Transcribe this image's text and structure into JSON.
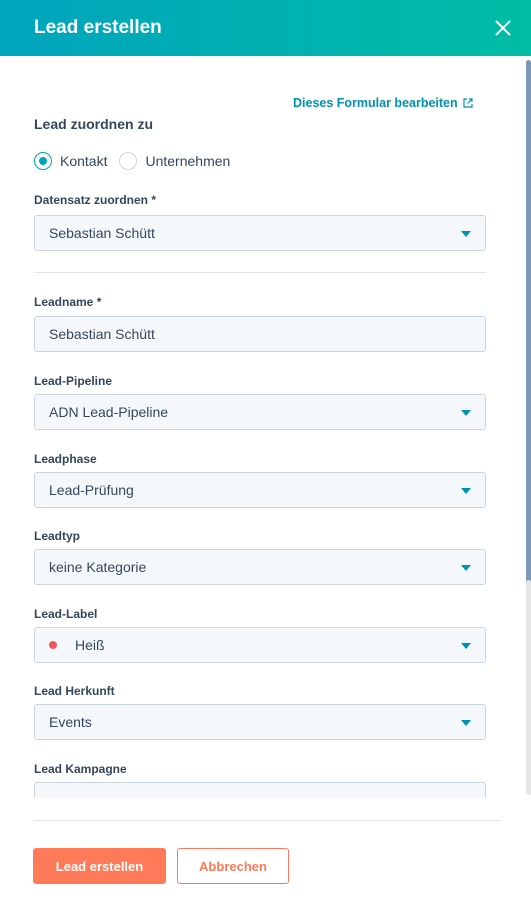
{
  "header": {
    "title": "Lead erstellen"
  },
  "form": {
    "edit_link": "Dieses Formular bearbeiten",
    "section_title": "Lead zuordnen zu",
    "radios": [
      {
        "label": "Kontakt",
        "checked": true
      },
      {
        "label": "Unternehmen",
        "checked": false
      }
    ],
    "fields": {
      "record": {
        "label": "Datensatz zuordnen *",
        "value": "Sebastian Schütt"
      },
      "leadname": {
        "label": "Leadname *",
        "value": "Sebastian Schütt"
      },
      "pipeline": {
        "label": "Lead-Pipeline",
        "value": "ADN Lead-Pipeline"
      },
      "phase": {
        "label": "Leadphase",
        "value": "Lead-Prüfung"
      },
      "type": {
        "label": "Leadtyp",
        "value": "keine Kategorie"
      },
      "label": {
        "label": "Lead-Label",
        "value": "Heiß",
        "dot_color": "#f2545b"
      },
      "source": {
        "label": "Lead Herkunft",
        "value": "Events"
      },
      "campaign": {
        "label": "Lead Kampagne",
        "value": ""
      }
    }
  },
  "footer": {
    "create_label": "Lead erstellen",
    "cancel_label": "Abbrechen"
  },
  "colors": {
    "header_start": "#00a4bd",
    "header_end": "#00bda5",
    "accent": "#0091ae",
    "primary_button": "#ff7a59"
  }
}
